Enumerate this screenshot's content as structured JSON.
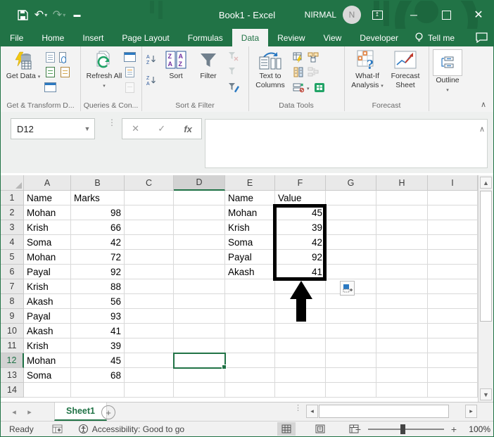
{
  "window": {
    "title": "Book1 - Excel",
    "user": "NIRMAL",
    "avatar_initial": "N"
  },
  "tabs": [
    {
      "label": "File",
      "active": false
    },
    {
      "label": "Home",
      "active": false
    },
    {
      "label": "Insert",
      "active": false
    },
    {
      "label": "Page Layout",
      "active": false
    },
    {
      "label": "Formulas",
      "active": false
    },
    {
      "label": "Data",
      "active": true
    },
    {
      "label": "Review",
      "active": false
    },
    {
      "label": "View",
      "active": false
    },
    {
      "label": "Developer",
      "active": false
    }
  ],
  "tellme_label": "Tell me",
  "ribbon": {
    "groups": [
      {
        "label": "Get & Transform D...",
        "buttons": [
          {
            "label": "Get Data",
            "dropdown": true
          }
        ]
      },
      {
        "label": "Queries & Con...",
        "buttons": [
          {
            "label": "Refresh All",
            "dropdown": true
          }
        ]
      },
      {
        "label": "Sort & Filter",
        "buttons": [
          {
            "label": "Sort"
          },
          {
            "label": "Filter"
          }
        ]
      },
      {
        "label": "Data Tools",
        "buttons": [
          {
            "label": "Text to Columns"
          }
        ]
      },
      {
        "label": "Forecast",
        "buttons": [
          {
            "label": "What-If Analysis",
            "dropdown": true
          },
          {
            "label": "Forecast Sheet"
          }
        ]
      },
      {
        "label": "",
        "buttons": [
          {
            "label": "Outline",
            "dropdown": true
          }
        ]
      }
    ]
  },
  "formula_bar": {
    "name_box": "D12",
    "formula": ""
  },
  "sheet": {
    "col_headers": [
      "A",
      "B",
      "C",
      "D",
      "E",
      "F",
      "G",
      "H",
      "I"
    ],
    "selected_column": "D",
    "selected_row": 12,
    "active_cell": "D12",
    "rows": [
      {
        "num": 1,
        "cells": {
          "A": "Name",
          "B": "Marks",
          "E": "Name",
          "F": "Value"
        }
      },
      {
        "num": 2,
        "cells": {
          "A": "Mohan",
          "B": "98",
          "E": "Mohan",
          "F": "45"
        }
      },
      {
        "num": 3,
        "cells": {
          "A": "Krish",
          "B": "66",
          "E": "Krish",
          "F": "39"
        }
      },
      {
        "num": 4,
        "cells": {
          "A": "Soma",
          "B": "42",
          "E": "Soma",
          "F": "42"
        }
      },
      {
        "num": 5,
        "cells": {
          "A": "Mohan",
          "B": "72",
          "E": "Payal",
          "F": "92"
        }
      },
      {
        "num": 6,
        "cells": {
          "A": "Payal",
          "B": "92",
          "E": "Akash",
          "F": "41"
        }
      },
      {
        "num": 7,
        "cells": {
          "A": "Krish",
          "B": "88"
        }
      },
      {
        "num": 8,
        "cells": {
          "A": "Akash",
          "B": "56"
        }
      },
      {
        "num": 9,
        "cells": {
          "A": "Payal",
          "B": "93"
        }
      },
      {
        "num": 10,
        "cells": {
          "A": "Akash",
          "B": "41"
        }
      },
      {
        "num": 11,
        "cells": {
          "A": "Krish",
          "B": "39"
        }
      },
      {
        "num": 12,
        "cells": {
          "A": "Mohan",
          "B": "45"
        }
      },
      {
        "num": 13,
        "cells": {
          "A": "Soma",
          "B": "68"
        }
      },
      {
        "num": 14,
        "cells": {}
      }
    ]
  },
  "annotation": {
    "highlighted_range": "F2:F6",
    "shape": "black rectangle with upward arrow"
  },
  "sheet_tabs": {
    "active": "Sheet1"
  },
  "status_bar": {
    "mode": "Ready",
    "accessibility": "Accessibility: Good to go",
    "zoom_level": "100%"
  },
  "colors": {
    "excel_green": "#217346",
    "refresh_green": "#21a366",
    "selection_green": "#1e7145"
  }
}
